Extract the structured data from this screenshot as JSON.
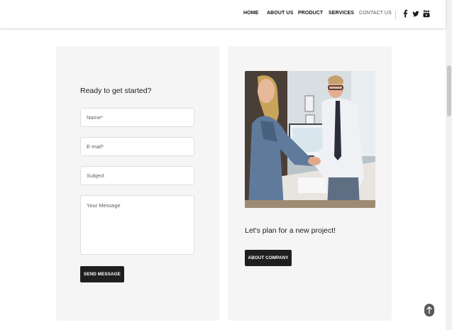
{
  "nav": {
    "items": [
      {
        "label": "HOME"
      },
      {
        "label": "ABOUT US"
      },
      {
        "label": "PRODUCT"
      },
      {
        "label": "SERVICES"
      },
      {
        "label": "CONTACT US"
      }
    ],
    "social": [
      "facebook-icon",
      "twitter-icon",
      "youtube-icon"
    ]
  },
  "contact_form": {
    "heading": "Ready to get started?",
    "name_placeholder": "Name*",
    "email_placeholder": "E-mail*",
    "subject_placeholder": "Subject",
    "message_placeholder": "Your Message",
    "send_label": "SEND MESSAGE"
  },
  "project": {
    "heading": "Let's plan for a new project!",
    "button_label": "ABOUT COMPANY"
  },
  "colors": {
    "card_bg": "#f5f5f5",
    "button_bg": "#1f1f1f",
    "to_top_bg": "#5a5a5a"
  }
}
